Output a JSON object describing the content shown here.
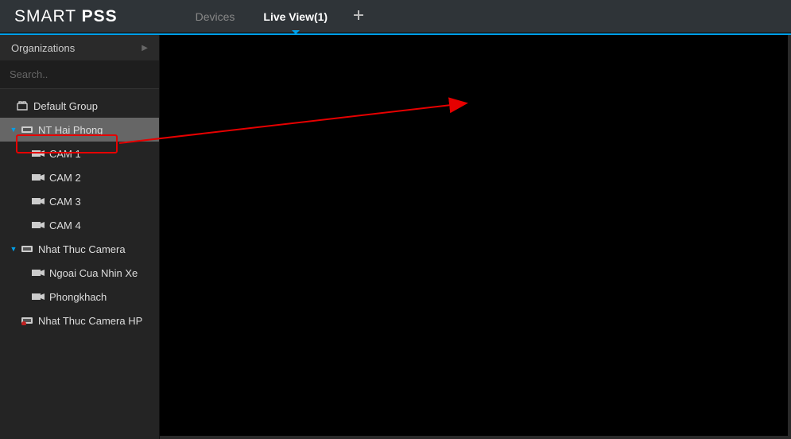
{
  "app": {
    "title_light": "SMART ",
    "title_bold": "PSS"
  },
  "tabs": {
    "devices": "Devices",
    "liveview": "Live View(1)"
  },
  "sidebar": {
    "org_label": "Organizations",
    "search_placeholder": "Search.."
  },
  "tree": {
    "root": "Default Group",
    "nodes": [
      {
        "label": "NT Hai Phong",
        "type": "device",
        "selected": true,
        "children": [
          "CAM 1",
          "CAM 2",
          "CAM 3",
          "CAM 4"
        ]
      },
      {
        "label": "Nhat Thuc Camera",
        "type": "device",
        "children": [
          "Ngoai Cua Nhin Xe",
          "Phongkhach"
        ]
      },
      {
        "label": "Nhat Thuc Camera HP",
        "type": "device-offline",
        "children": []
      }
    ]
  },
  "colors": {
    "accent": "#00a0e9",
    "annotation": "#e60000"
  }
}
